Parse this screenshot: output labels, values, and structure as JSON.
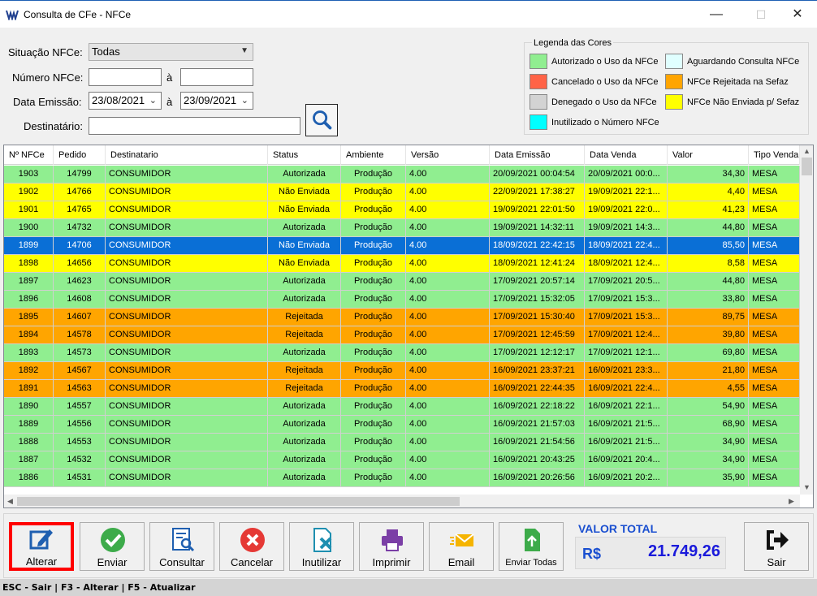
{
  "window": {
    "title": "Consulta de CFe - NFCe",
    "minimize": "—",
    "maximize": "☐",
    "close": "✕"
  },
  "filters": {
    "situacao_label": "Situação NFCe:",
    "situacao_value": "Todas",
    "numero_label": "Número NFCe:",
    "numero_value": "",
    "numero_to_value": "",
    "data_label": "Data Emissão:",
    "data_from": "23/08/2021",
    "data_to": "23/09/2021",
    "range_sep": "à",
    "destinatario_label": "Destinatário:",
    "destinatario_value": ""
  },
  "legend": {
    "title": "Legenda das Cores",
    "items": [
      {
        "label": "Autorizado o Uso da NFCe",
        "color": "#90ee90"
      },
      {
        "label": "Cancelado o Uso da NFCe",
        "color": "#ff6347"
      },
      {
        "label": "Denegado o Uso da NFCe",
        "color": "#d3d3d3"
      },
      {
        "label": "Inutilizado o Número NFCe",
        "color": "#00ffff"
      },
      {
        "label": "Aguardando Consulta NFCe",
        "color": "#e0ffff"
      },
      {
        "label": "NFCe Rejeitada na Sefaz",
        "color": "#ffa500"
      },
      {
        "label": "NFCe Não Enviada p/ Sefaz",
        "color": "#ffff00"
      }
    ]
  },
  "table": {
    "columns": [
      "Nº NFCe",
      "Pedido",
      "Destinatario",
      "Status",
      "Ambiente",
      "Versão",
      "Data Emissão",
      "Data Venda",
      "Valor",
      "Tipo Venda"
    ],
    "status_colors": {
      "Autorizada": "#90ee90",
      "Não Enviada": "#ffff00",
      "Rejeitada": "#ffa500",
      "Selected": "#0a6fd6"
    },
    "selected_row": 4,
    "rows": [
      [
        "1903",
        "14799",
        "CONSUMIDOR",
        "Autorizada",
        "Produção",
        "4.00",
        "20/09/2021 00:04:54",
        "20/09/2021 00:0...",
        "34,30",
        "MESA"
      ],
      [
        "1902",
        "14766",
        "CONSUMIDOR",
        "Não Enviada",
        "Produção",
        "4.00",
        "22/09/2021 17:38:27",
        "19/09/2021 22:1...",
        "4,40",
        "MESA"
      ],
      [
        "1901",
        "14765",
        "CONSUMIDOR",
        "Não Enviada",
        "Produção",
        "4.00",
        "19/09/2021 22:01:50",
        "19/09/2021 22:0...",
        "41,23",
        "MESA"
      ],
      [
        "1900",
        "14732",
        "CONSUMIDOR",
        "Autorizada",
        "Produção",
        "4.00",
        "19/09/2021 14:32:11",
        "19/09/2021 14:3...",
        "44,80",
        "MESA"
      ],
      [
        "1899",
        "14706",
        "CONSUMIDOR",
        "Não Enviada",
        "Produção",
        "4.00",
        "18/09/2021 22:42:15",
        "18/09/2021 22:4...",
        "85,50",
        "MESA"
      ],
      [
        "1898",
        "14656",
        "CONSUMIDOR",
        "Não Enviada",
        "Produção",
        "4.00",
        "18/09/2021 12:41:24",
        "18/09/2021 12:4...",
        "8,58",
        "MESA"
      ],
      [
        "1897",
        "14623",
        "CONSUMIDOR",
        "Autorizada",
        "Produção",
        "4.00",
        "17/09/2021 20:57:14",
        "17/09/2021 20:5...",
        "44,80",
        "MESA"
      ],
      [
        "1896",
        "14608",
        "CONSUMIDOR",
        "Autorizada",
        "Produção",
        "4.00",
        "17/09/2021 15:32:05",
        "17/09/2021 15:3...",
        "33,80",
        "MESA"
      ],
      [
        "1895",
        "14607",
        "CONSUMIDOR",
        "Rejeitada",
        "Produção",
        "4.00",
        "17/09/2021 15:30:40",
        "17/09/2021 15:3...",
        "89,75",
        "MESA"
      ],
      [
        "1894",
        "14578",
        "CONSUMIDOR",
        "Rejeitada",
        "Produção",
        "4.00",
        "17/09/2021 12:45:59",
        "17/09/2021 12:4...",
        "39,80",
        "MESA"
      ],
      [
        "1893",
        "14573",
        "CONSUMIDOR",
        "Autorizada",
        "Produção",
        "4.00",
        "17/09/2021 12:12:17",
        "17/09/2021 12:1...",
        "69,80",
        "MESA"
      ],
      [
        "1892",
        "14567",
        "CONSUMIDOR",
        "Rejeitada",
        "Produção",
        "4.00",
        "16/09/2021 23:37:21",
        "16/09/2021 23:3...",
        "21,80",
        "MESA"
      ],
      [
        "1891",
        "14563",
        "CONSUMIDOR",
        "Rejeitada",
        "Produção",
        "4.00",
        "16/09/2021 22:44:35",
        "16/09/2021 22:4...",
        "4,55",
        "MESA"
      ],
      [
        "1890",
        "14557",
        "CONSUMIDOR",
        "Autorizada",
        "Produção",
        "4.00",
        "16/09/2021 22:18:22",
        "16/09/2021 22:1...",
        "54,90",
        "MESA"
      ],
      [
        "1889",
        "14556",
        "CONSUMIDOR",
        "Autorizada",
        "Produção",
        "4.00",
        "16/09/2021 21:57:03",
        "16/09/2021 21:5...",
        "68,90",
        "MESA"
      ],
      [
        "1888",
        "14553",
        "CONSUMIDOR",
        "Autorizada",
        "Produção",
        "4.00",
        "16/09/2021 21:54:56",
        "16/09/2021 21:5...",
        "34,90",
        "MESA"
      ],
      [
        "1887",
        "14532",
        "CONSUMIDOR",
        "Autorizada",
        "Produção",
        "4.00",
        "16/09/2021 20:43:25",
        "16/09/2021 20:4...",
        "34,90",
        "MESA"
      ],
      [
        "1886",
        "14531",
        "CONSUMIDOR",
        "Autorizada",
        "Produção",
        "4.00",
        "16/09/2021 20:26:56",
        "16/09/2021 20:2...",
        "35,90",
        "MESA"
      ]
    ]
  },
  "toolbar": {
    "alterar": "Alterar",
    "enviar": "Enviar",
    "consultar": "Consultar",
    "cancelar": "Cancelar",
    "inutilizar": "Inutilizar",
    "imprimir": "Imprimir",
    "email": "Email",
    "enviar_todas": "Enviar Todas",
    "sair": "Sair"
  },
  "total": {
    "title": "VALOR TOTAL",
    "currency": "R$",
    "value": "21.749,26"
  },
  "statusbar": {
    "text": "ESC - Sair | F3 - Alterar  |  F5 - Atualizar"
  }
}
